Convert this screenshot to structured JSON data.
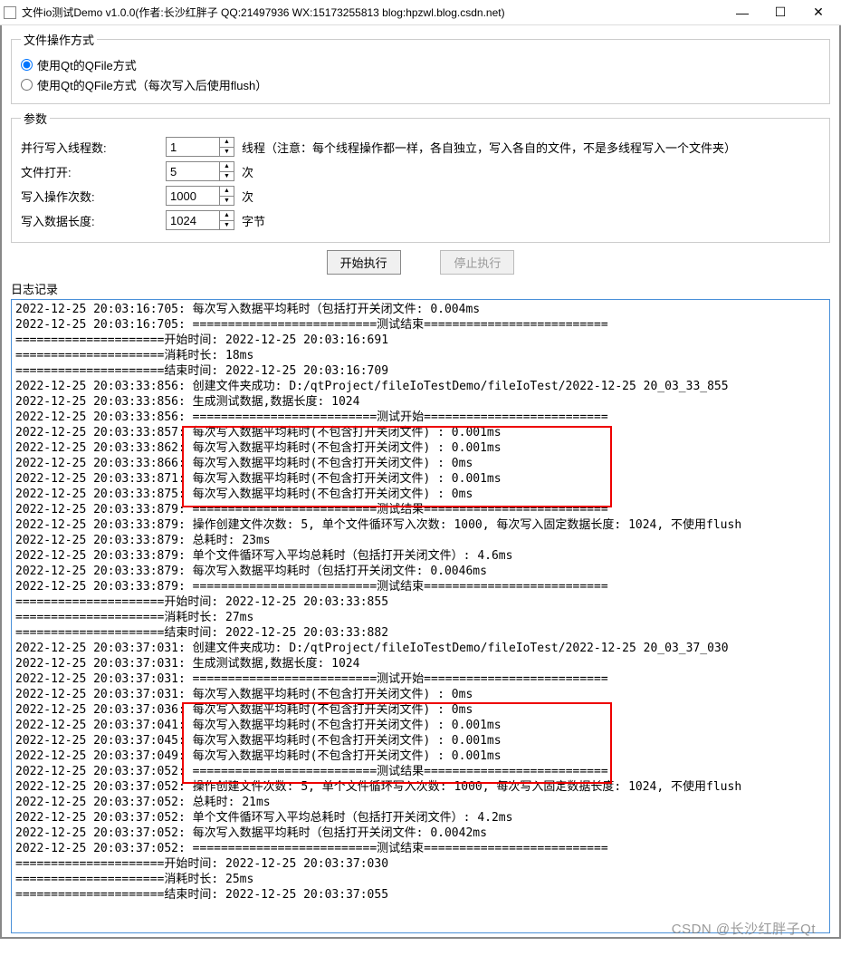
{
  "window": {
    "title": "文件io测试Demo v1.0.0(作者:长沙红胖子 QQ:21497936 WX:15173255813 blog:hpzwl.blog.csdn.net)"
  },
  "group_mode": {
    "legend": "文件操作方式",
    "opt1": "使用Qt的QFile方式",
    "opt2": "使用Qt的QFile方式（每次写入后使用flush）"
  },
  "group_params": {
    "legend": "参数",
    "threads_label": "并行写入线程数:",
    "threads_value": "1",
    "threads_after": "线程（注意：每个线程操作都一样，各自独立，写入各自的文件，不是多线程写入一个文件夹）",
    "open_label": "文件打开:",
    "open_value": "5",
    "open_after": "次",
    "writes_label": "写入操作次数:",
    "writes_value": "1000",
    "writes_after": "次",
    "len_label": "写入数据长度:",
    "len_value": "1024",
    "len_after": "字节"
  },
  "buttons": {
    "start": "开始执行",
    "stop": "停止执行"
  },
  "loglabel": "日志记录",
  "log": [
    "2022-12-25 20:03:16:705:  每次写入数据平均耗时（包括打开关闭文件: 0.004ms",
    "2022-12-25 20:03:16:705:  ==========================测试结束==========================",
    "=====================开始时间: 2022-12-25 20:03:16:691",
    "=====================消耗时长: 18ms",
    "=====================结束时间: 2022-12-25 20:03:16:709",
    "2022-12-25 20:03:33:856:  创建文件夹成功: D:/qtProject/fileIoTestDemo/fileIoTest/2022-12-25 20_03_33_855",
    "2022-12-25 20:03:33:856:  生成测试数据,数据长度: 1024",
    "2022-12-25 20:03:33:856:  ==========================测试开始==========================",
    "2022-12-25 20:03:33:857:  每次写入数据平均耗时(不包含打开关闭文件) : 0.001ms",
    "2022-12-25 20:03:33:862:  每次写入数据平均耗时(不包含打开关闭文件) : 0.001ms",
    "2022-12-25 20:03:33:866:  每次写入数据平均耗时(不包含打开关闭文件) : 0ms",
    "2022-12-25 20:03:33:871:  每次写入数据平均耗时(不包含打开关闭文件) : 0.001ms",
    "2022-12-25 20:03:33:875:  每次写入数据平均耗时(不包含打开关闭文件) : 0ms",
    "2022-12-25 20:03:33:879:  ==========================测试结果==========================",
    "2022-12-25 20:03:33:879:  操作创建文件次数: 5, 单个文件循环写入次数: 1000, 每次写入固定数据长度: 1024, 不使用flush",
    "2022-12-25 20:03:33:879:  总耗时: 23ms",
    "2022-12-25 20:03:33:879:  单个文件循环写入平均总耗时（包括打开关闭文件）: 4.6ms",
    "2022-12-25 20:03:33:879:  每次写入数据平均耗时（包括打开关闭文件: 0.0046ms",
    "2022-12-25 20:03:33:879:  ==========================测试结束==========================",
    "=====================开始时间: 2022-12-25 20:03:33:855",
    "=====================消耗时长: 27ms",
    "=====================结束时间: 2022-12-25 20:03:33:882",
    "2022-12-25 20:03:37:031:  创建文件夹成功: D:/qtProject/fileIoTestDemo/fileIoTest/2022-12-25 20_03_37_030",
    "2022-12-25 20:03:37:031:  生成测试数据,数据长度: 1024",
    "2022-12-25 20:03:37:031:  ==========================测试开始==========================",
    "2022-12-25 20:03:37:031:  每次写入数据平均耗时(不包含打开关闭文件) : 0ms",
    "2022-12-25 20:03:37:036:  每次写入数据平均耗时(不包含打开关闭文件) : 0ms",
    "2022-12-25 20:03:37:041:  每次写入数据平均耗时(不包含打开关闭文件) : 0.001ms",
    "2022-12-25 20:03:37:045:  每次写入数据平均耗时(不包含打开关闭文件) : 0.001ms",
    "2022-12-25 20:03:37:049:  每次写入数据平均耗时(不包含打开关闭文件) : 0.001ms",
    "2022-12-25 20:03:37:052:  ==========================测试结果==========================",
    "2022-12-25 20:03:37:052:  操作创建文件次数: 5, 单个文件循环写入次数: 1000, 每次写入固定数据长度: 1024, 不使用flush",
    "2022-12-25 20:03:37:052:  总耗时: 21ms",
    "2022-12-25 20:03:37:052:  单个文件循环写入平均总耗时（包括打开关闭文件）: 4.2ms",
    "2022-12-25 20:03:37:052:  每次写入数据平均耗时（包括打开关闭文件: 0.0042ms",
    "2022-12-25 20:03:37:052:  ==========================测试结束==========================",
    "=====================开始时间: 2022-12-25 20:03:37:030",
    "=====================消耗时长: 25ms",
    "=====================结束时间: 2022-12-25 20:03:37:055"
  ],
  "watermark": "CSDN @长沙红胖子Qt"
}
